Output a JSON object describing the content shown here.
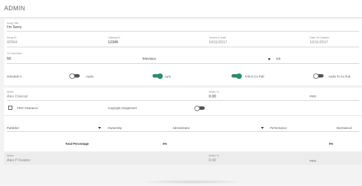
{
  "header": {
    "title": "ADMIN"
  },
  "song": {
    "title_label": "Song Title",
    "title_value": "I'm Sorry",
    "song_id_label": "Song ID",
    "song_id_value": "42564",
    "catalog_id_label": "Catalog ID",
    "catalog_id_value": "12345",
    "turned_in_label": "Turned In Date",
    "turned_in_value": "10/11/2017",
    "created_label": "Date Of Creation",
    "created_value": "10/11/2017",
    "controlled_label": "% Controlled",
    "controlled_value": "50",
    "type_value": "Television",
    "country_value": "US"
  },
  "toggles": {
    "schedule_a": "Schedule A",
    "audio": "Audio",
    "lyric": "Lyric",
    "info_co_pub": "Info to Co Pub",
    "audio_co_pub": "Audio To Co Pub"
  },
  "writer1": {
    "writer_label": "Writer",
    "writer_value": "Alex Dolesal",
    "share_label": "Writer %",
    "share_value": "0.00",
    "pro_label": "PRO",
    "pro_clearance": "PRO Clearance",
    "copyright_assignment": "Copyright Assignment"
  },
  "publisher_row": {
    "publisher": "Publisher",
    "ownership": "Ownership",
    "administrator": "Administrator",
    "performance": "Performance",
    "mechanical": "Mechanical"
  },
  "totals": {
    "label": "Total Percentage",
    "value1": "0%",
    "value2": "0%"
  },
  "writer2": {
    "writer_label": "Writer",
    "writer_value": "Alex P Keaton",
    "share_label": "Writer %",
    "share_value": "0.00",
    "pro_label": "PRO"
  }
}
